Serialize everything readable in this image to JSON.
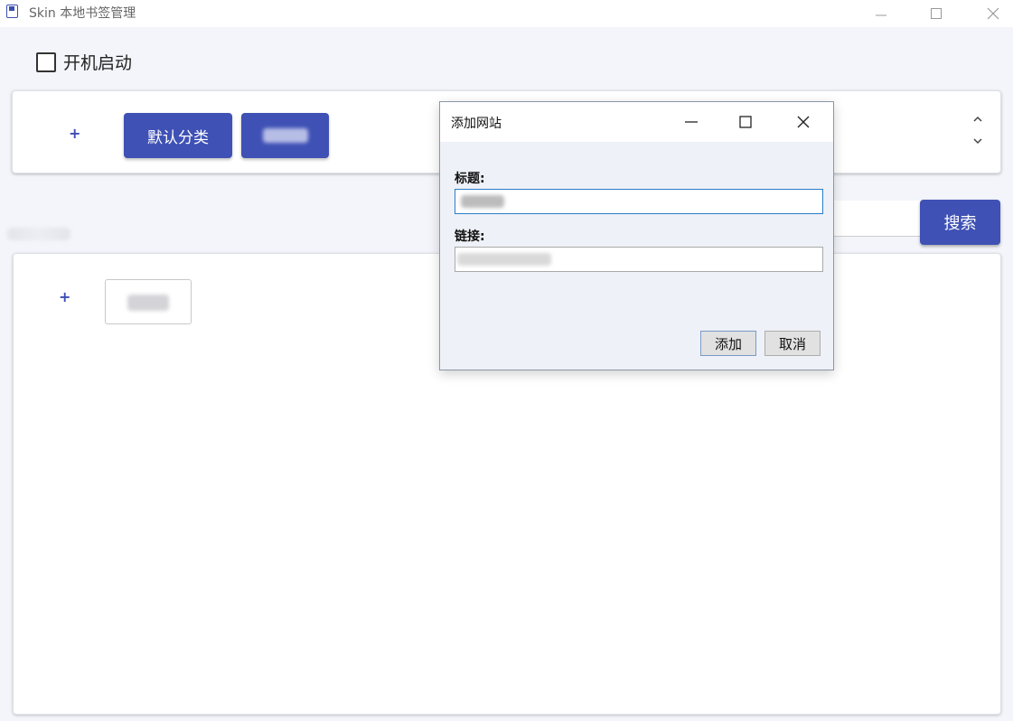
{
  "window": {
    "title": "Skin 本地书签管理",
    "icons": {
      "app": "bookmark-app-icon",
      "minimize": "minimize-icon",
      "maximize": "maximize-icon",
      "close": "close-icon"
    }
  },
  "settings": {
    "autostart_label": "开机启动",
    "autostart_checked": false
  },
  "categories": {
    "add_symbol": "+",
    "items": [
      {
        "label": "默认分类"
      }
    ]
  },
  "search": {
    "button_label": "搜索"
  },
  "bookmarks": {
    "add_symbol": "+"
  },
  "dialog": {
    "title": "添加网站",
    "title_label": "标题:",
    "link_label": "链接:",
    "add_button": "添加",
    "cancel_button": "取消"
  },
  "colors": {
    "accent": "#3f51b5",
    "background": "#f3f5fa",
    "focus": "#2a7dc8"
  }
}
